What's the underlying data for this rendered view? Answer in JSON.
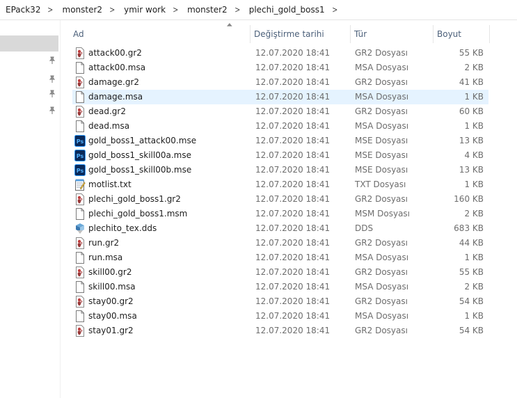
{
  "breadcrumb": [
    "EPack32",
    "monster2",
    "ymir work",
    "monster2",
    "plechi_gold_boss1"
  ],
  "columns": {
    "name": "Ad",
    "date": "Değiştirme tarihi",
    "type": "Tür",
    "size": "Boyut"
  },
  "files": [
    {
      "name": "attack00.gr2",
      "date": "12.07.2020 18:41",
      "type": "GR2 Dosyası",
      "size": "55 KB",
      "icon": "gr2-file-icon"
    },
    {
      "name": "attack00.msa",
      "date": "12.07.2020 18:41",
      "type": "MSA Dosyası",
      "size": "2 KB",
      "icon": "blank-file-icon"
    },
    {
      "name": "damage.gr2",
      "date": "12.07.2020 18:41",
      "type": "GR2 Dosyası",
      "size": "41 KB",
      "icon": "gr2-file-icon"
    },
    {
      "name": "damage.msa",
      "date": "12.07.2020 18:41",
      "type": "MSA Dosyası",
      "size": "1 KB",
      "icon": "blank-file-icon",
      "selected": true
    },
    {
      "name": "dead.gr2",
      "date": "12.07.2020 18:41",
      "type": "GR2 Dosyası",
      "size": "60 KB",
      "icon": "gr2-file-icon"
    },
    {
      "name": "dead.msa",
      "date": "12.07.2020 18:41",
      "type": "MSA Dosyası",
      "size": "1 KB",
      "icon": "blank-file-icon"
    },
    {
      "name": "gold_boss1_attack00.mse",
      "date": "12.07.2020 18:41",
      "type": "MSE Dosyası",
      "size": "13 KB",
      "icon": "photoshop-file-icon"
    },
    {
      "name": "gold_boss1_skill00a.mse",
      "date": "12.07.2020 18:41",
      "type": "MSE Dosyası",
      "size": "4 KB",
      "icon": "photoshop-file-icon"
    },
    {
      "name": "gold_boss1_skill00b.mse",
      "date": "12.07.2020 18:41",
      "type": "MSE Dosyası",
      "size": "13 KB",
      "icon": "photoshop-file-icon"
    },
    {
      "name": "motlist.txt",
      "date": "12.07.2020 18:41",
      "type": "TXT Dosyası",
      "size": "1 KB",
      "icon": "notepad-file-icon"
    },
    {
      "name": "plechi_gold_boss1.gr2",
      "date": "12.07.2020 18:41",
      "type": "GR2 Dosyası",
      "size": "160 KB",
      "icon": "gr2-file-icon"
    },
    {
      "name": "plechi_gold_boss1.msm",
      "date": "12.07.2020 18:41",
      "type": "MSM Dosyası",
      "size": "2 KB",
      "icon": "blank-file-icon"
    },
    {
      "name": "plechito_tex.dds",
      "date": "12.07.2020 18:41",
      "type": "DDS",
      "size": "683 KB",
      "icon": "dds-file-icon"
    },
    {
      "name": "run.gr2",
      "date": "12.07.2020 18:41",
      "type": "GR2 Dosyası",
      "size": "44 KB",
      "icon": "gr2-file-icon"
    },
    {
      "name": "run.msa",
      "date": "12.07.2020 18:41",
      "type": "MSA Dosyası",
      "size": "1 KB",
      "icon": "blank-file-icon"
    },
    {
      "name": "skill00.gr2",
      "date": "12.07.2020 18:41",
      "type": "GR2 Dosyası",
      "size": "55 KB",
      "icon": "gr2-file-icon"
    },
    {
      "name": "skill00.msa",
      "date": "12.07.2020 18:41",
      "type": "MSA Dosyası",
      "size": "2 KB",
      "icon": "blank-file-icon"
    },
    {
      "name": "stay00.gr2",
      "date": "12.07.2020 18:41",
      "type": "GR2 Dosyası",
      "size": "54 KB",
      "icon": "gr2-file-icon"
    },
    {
      "name": "stay00.msa",
      "date": "12.07.2020 18:41",
      "type": "MSA Dosyası",
      "size": "1 KB",
      "icon": "blank-file-icon"
    },
    {
      "name": "stay01.gr2",
      "date": "12.07.2020 18:41",
      "type": "GR2 Dosyası",
      "size": "54 KB",
      "icon": "gr2-file-icon"
    }
  ],
  "colors": {
    "selection": "#e5f3ff",
    "header_text": "#4c607a",
    "photoshop": "#0a2a5a",
    "nav_selected": "#d9d9d9"
  }
}
